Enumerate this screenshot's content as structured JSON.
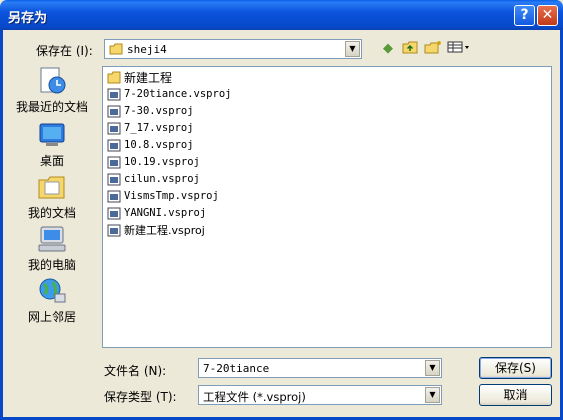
{
  "window": {
    "title": "另存为",
    "help": "?",
    "close": "✕"
  },
  "save_in": {
    "label": "保存在 (I):",
    "value": "sheji4"
  },
  "places": [
    {
      "label": "我最近的文档",
      "icon": "recent-documents-icon"
    },
    {
      "label": "桌面",
      "icon": "desktop-icon"
    },
    {
      "label": "我的文档",
      "icon": "my-documents-icon"
    },
    {
      "label": "我的电脑",
      "icon": "my-computer-icon"
    },
    {
      "label": "网上邻居",
      "icon": "network-places-icon"
    }
  ],
  "files": [
    {
      "name": "新建工程",
      "type": "folder"
    },
    {
      "name": "7-20tiance.vsproj",
      "type": "file"
    },
    {
      "name": "7-30.vsproj",
      "type": "file"
    },
    {
      "name": "7_17.vsproj",
      "type": "file"
    },
    {
      "name": "10.8.vsproj",
      "type": "file"
    },
    {
      "name": "10.19.vsproj",
      "type": "file"
    },
    {
      "name": "cilun.vsproj",
      "type": "file"
    },
    {
      "name": "VismsTmp.vsproj",
      "type": "file"
    },
    {
      "name": "YANGNI.vsproj",
      "type": "file"
    },
    {
      "name": "新建工程.vsproj",
      "type": "file"
    }
  ],
  "filename": {
    "label": "文件名 (N):",
    "value": "7-20tiance"
  },
  "filetype": {
    "label": "保存类型 (T):",
    "value": "工程文件 (*.vsproj)"
  },
  "buttons": {
    "save": "保存(S)",
    "cancel": "取消"
  }
}
